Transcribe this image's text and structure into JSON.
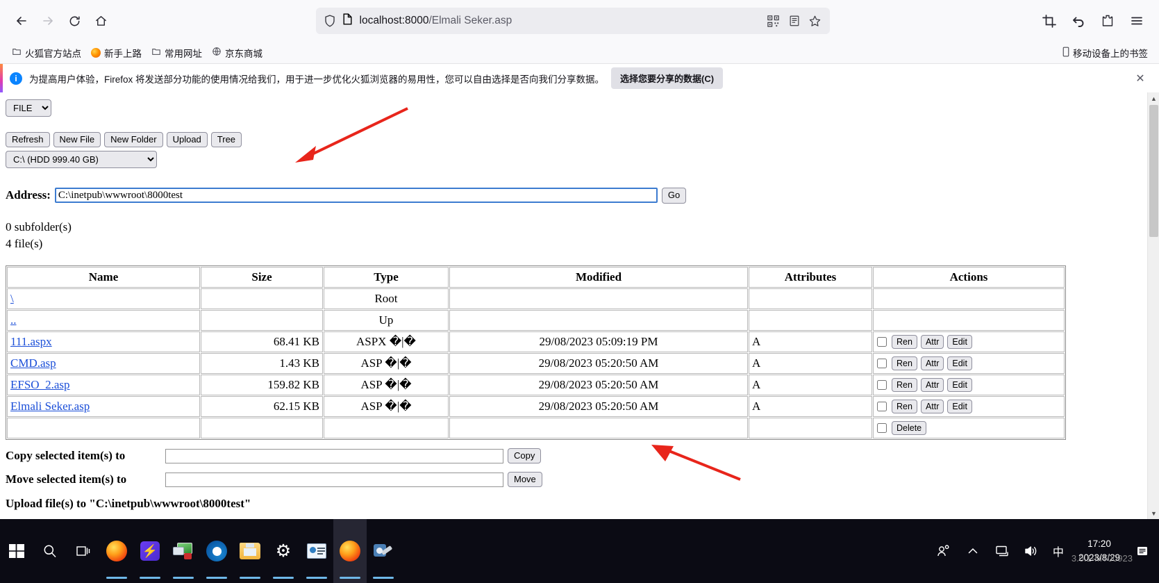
{
  "browser": {
    "url_host": "localhost:8000",
    "url_path": "/Elmali Seker.asp",
    "nav": {
      "back": "back-arrow",
      "forward": "forward-arrow",
      "reload": "reload",
      "home": "home"
    },
    "bookmarks": [
      {
        "label": "火狐官方站点",
        "icon": "folder-icon"
      },
      {
        "label": "新手上路",
        "icon": "firefox-icon"
      },
      {
        "label": "常用网址",
        "icon": "folder-icon"
      },
      {
        "label": "京东商城",
        "icon": "globe-icon"
      }
    ],
    "bookmarks_right": {
      "label": "移动设备上的书签",
      "icon": "mobile-icon"
    },
    "notification": {
      "text": "为提高用户体验，Firefox 将发送部分功能的使用情况给我们，用于进一步优化火狐浏览器的易用性，您可以自由选择是否向我们分享数据。",
      "button": "选择您要分享的数据(C)",
      "close": "✕"
    }
  },
  "page": {
    "mode_select": {
      "value": "FILE",
      "options": [
        "FILE"
      ]
    },
    "toolbar_buttons": [
      "Refresh",
      "New File",
      "New Folder",
      "Upload",
      "Tree"
    ],
    "drive_select": {
      "value": "C:\\ (HDD 999.40 GB)",
      "options": [
        "C:\\ (HDD 999.40 GB)"
      ]
    },
    "address": {
      "label": "Address:",
      "value": "C:\\inetpub\\wwwroot\\8000test",
      "go_button": "Go"
    },
    "counts": {
      "subfolders": "0 subfolder(s)",
      "files": "4 file(s)"
    },
    "table": {
      "headers": [
        "Name",
        "Size",
        "Type",
        "Modified",
        "Attributes",
        "Actions"
      ],
      "rows": [
        {
          "name": "\\",
          "link": true,
          "size": "",
          "type": "Root",
          "modified": "",
          "attributes": "",
          "actions": false
        },
        {
          "name": "..",
          "link": true,
          "size": "",
          "type": "Up",
          "modified": "",
          "attributes": "",
          "actions": false
        },
        {
          "name": "111.aspx",
          "link": true,
          "size": "68.41 KB",
          "type": "ASPX �|�",
          "modified": "29/08/2023 05:09:19 PM",
          "attributes": "A",
          "actions": true
        },
        {
          "name": "CMD.asp",
          "link": true,
          "size": "1.43 KB",
          "type": "ASP �|�",
          "modified": "29/08/2023 05:20:50 AM",
          "attributes": "A",
          "actions": true
        },
        {
          "name": "EFSO_2.asp",
          "link": true,
          "size": "159.82 KB",
          "type": "ASP �|�",
          "modified": "29/08/2023 05:20:50 AM",
          "attributes": "A",
          "actions": true
        },
        {
          "name": "Elmali Seker.asp",
          "link": true,
          "size": "62.15 KB",
          "type": "ASP �|�",
          "modified": "29/08/2023 05:20:50 AM",
          "attributes": "A",
          "actions": true
        }
      ],
      "row_action_labels": [
        "Ren",
        "Attr",
        "Edit"
      ],
      "footer_row": {
        "delete_label": "Delete"
      }
    },
    "copy": {
      "label": "Copy selected item(s) to",
      "value": "",
      "button": "Copy"
    },
    "move": {
      "label": "Move selected item(s) to",
      "value": "",
      "button": "Move"
    },
    "upload_line": "Upload file(s) to \"C:\\inetpub\\wwwroot\\8000test\""
  },
  "taskbar": {
    "items": [
      {
        "name": "start-button",
        "icon": "windows-logo",
        "active": false,
        "running": false
      },
      {
        "name": "search-button",
        "icon": "search-icon",
        "active": false,
        "running": false
      },
      {
        "name": "task-view-button",
        "icon": "task-view-icon",
        "active": false,
        "running": false
      },
      {
        "name": "firefox-taskbar",
        "icon": "firefox-icon",
        "active": false,
        "running": true
      },
      {
        "name": "app-purple-taskbar",
        "icon": "bolt-icon",
        "active": false,
        "running": true
      },
      {
        "name": "remote-desktop-taskbar",
        "icon": "remote-desktop-icon",
        "active": false,
        "running": true
      },
      {
        "name": "edge-taskbar",
        "icon": "edge-icon",
        "active": false,
        "running": true
      },
      {
        "name": "explorer-taskbar",
        "icon": "folder-icon",
        "active": false,
        "running": true
      },
      {
        "name": "settings-taskbar",
        "icon": "gear-icon",
        "active": false,
        "running": true
      },
      {
        "name": "contacts-taskbar",
        "icon": "card-icon",
        "active": false,
        "running": true
      },
      {
        "name": "firefox-active-taskbar",
        "icon": "firefox-icon",
        "active": true,
        "running": true
      },
      {
        "name": "tool-taskbar",
        "icon": "tool-icon",
        "active": false,
        "running": true
      }
    ],
    "tray": {
      "people": "people-icon",
      "chevron": "chevron-up-icon",
      "network": "network-icon",
      "volume": "volume-icon",
      "ime": "中",
      "time": "17:20",
      "date": "2023/8/29",
      "watermark": "3.0.1-MT00923",
      "notifications": "notification-icon"
    }
  },
  "colors": {
    "accent_blue": "#0a84ff",
    "link_blue": "#1a4ed8",
    "arrow_red": "#e8251b",
    "taskbar_bg": "#0b0b14"
  }
}
